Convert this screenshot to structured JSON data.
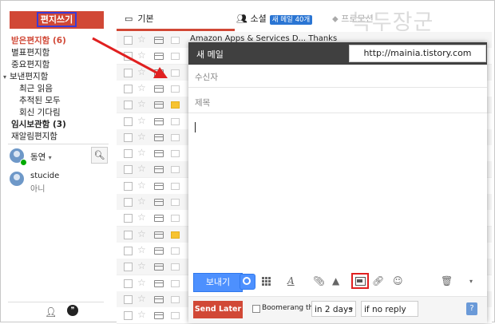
{
  "compose_button": "편지쓰기",
  "nav": [
    {
      "label": "받은편지함 (6)",
      "style": "red"
    },
    {
      "label": "별표편지함",
      "style": "normal"
    },
    {
      "label": "중요편지함",
      "style": "normal"
    },
    {
      "label": "보낸편지함",
      "style": "folder"
    },
    {
      "label": "최근 읽음",
      "style": "sub"
    },
    {
      "label": "추적된 모두",
      "style": "sub"
    },
    {
      "label": "회신 기다림",
      "style": "sub"
    },
    {
      "label": "임시보관함 (3)",
      "style": "bold"
    },
    {
      "label": "재알림편지함",
      "style": "normal"
    }
  ],
  "chat": {
    "me": "동연",
    "contact_name": "stucide",
    "contact_status": "아니"
  },
  "tabs": {
    "primary": "기본",
    "social": "소셜",
    "social_badge": "새 메일 40개",
    "promo": "프로모션"
  },
  "peek_text": "Amazon Apps & Services D... Thanks",
  "rows": [
    {
      "label": "white",
      "row": "grey"
    },
    {
      "label": "white",
      "row": "white"
    },
    {
      "label": "white",
      "row": "grey"
    },
    {
      "label": "white",
      "row": "white"
    },
    {
      "label": "yellow",
      "row": "grey"
    },
    {
      "label": "white",
      "row": "white"
    },
    {
      "label": "white",
      "row": "grey"
    },
    {
      "label": "white",
      "row": "white"
    },
    {
      "label": "white",
      "row": "grey"
    },
    {
      "label": "white",
      "row": "white"
    },
    {
      "label": "white",
      "row": "grey"
    },
    {
      "label": "white",
      "row": "white"
    },
    {
      "label": "yellow",
      "row": "grey"
    },
    {
      "label": "white",
      "row": "white"
    },
    {
      "label": "white",
      "row": "grey"
    },
    {
      "label": "white",
      "row": "white"
    },
    {
      "label": "white",
      "row": "grey"
    },
    {
      "label": "white",
      "row": "white"
    }
  ],
  "compose": {
    "title": "새 메일",
    "to_placeholder": "수신자",
    "subject_placeholder": "제목",
    "send": "보내기",
    "send_later": "Send Later",
    "boomerang": "Boomerang this",
    "when": "in 2 days",
    "condition": "if no reply",
    "help": "?"
  },
  "watermark": "녹두장군",
  "url": "http://mainia.tistory.com",
  "colors": {
    "accent_red": "#d14836",
    "blue": "#4d90fe",
    "header": "#404040",
    "highlight": "#e02020"
  }
}
